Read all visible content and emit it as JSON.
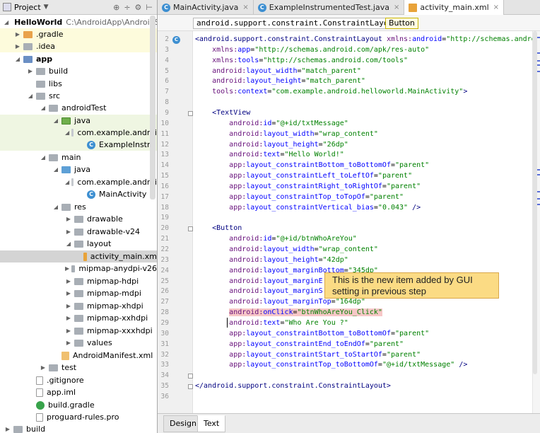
{
  "project_panel": {
    "title": "Project",
    "tree": [
      {
        "label": "HelloWorld",
        "path": "C:\\AndroidApp\\AndroidSt",
        "icon": "module-icon",
        "expanded": true,
        "bold": true
      },
      {
        "label": ".gradle",
        "icon": "folder-icon",
        "expanded": false
      },
      {
        "label": ".idea",
        "icon": "folder-icon",
        "expanded": false
      },
      {
        "label": "app",
        "icon": "module-icon",
        "expanded": true,
        "bold": true
      },
      {
        "label": "build",
        "icon": "folder-icon",
        "expanded": false
      },
      {
        "label": "libs",
        "icon": "folder-icon"
      },
      {
        "label": "src",
        "icon": "folder-icon",
        "expanded": true
      },
      {
        "label": "androidTest",
        "icon": "folder-icon",
        "expanded": true
      },
      {
        "label": "java",
        "icon": "test-source-folder-icon",
        "expanded": true
      },
      {
        "label": "com.example.androi",
        "icon": "package-icon",
        "expanded": true
      },
      {
        "label": "ExampleInstru",
        "icon": "class-icon"
      },
      {
        "label": "main",
        "icon": "folder-icon",
        "expanded": true
      },
      {
        "label": "java",
        "icon": "source-folder-icon",
        "expanded": true
      },
      {
        "label": "com.example.androi",
        "icon": "package-icon",
        "expanded": true
      },
      {
        "label": "MainActivity",
        "icon": "class-icon"
      },
      {
        "label": "res",
        "icon": "resource-folder-icon",
        "expanded": true
      },
      {
        "label": "drawable",
        "icon": "folder-icon",
        "expanded": false
      },
      {
        "label": "drawable-v24",
        "icon": "folder-icon",
        "expanded": false
      },
      {
        "label": "layout",
        "icon": "folder-icon",
        "expanded": true
      },
      {
        "label": "activity_main.xm",
        "icon": "xml-file-icon"
      },
      {
        "label": "mipmap-anydpi-v26",
        "icon": "folder-icon",
        "expanded": false
      },
      {
        "label": "mipmap-hdpi",
        "icon": "folder-icon",
        "expanded": false
      },
      {
        "label": "mipmap-mdpi",
        "icon": "folder-icon",
        "expanded": false
      },
      {
        "label": "mipmap-xhdpi",
        "icon": "folder-icon",
        "expanded": false
      },
      {
        "label": "mipmap-xxhdpi",
        "icon": "folder-icon",
        "expanded": false
      },
      {
        "label": "mipmap-xxxhdpi",
        "icon": "folder-icon",
        "expanded": false
      },
      {
        "label": "values",
        "icon": "folder-icon",
        "expanded": false
      },
      {
        "label": "AndroidManifest.xml",
        "icon": "manifest-file-icon"
      },
      {
        "label": "test",
        "icon": "folder-icon",
        "expanded": false
      },
      {
        "label": ".gitignore",
        "icon": "file-icon"
      },
      {
        "label": "app.iml",
        "icon": "iml-file-icon"
      },
      {
        "label": "build.gradle",
        "icon": "gradle-icon"
      },
      {
        "label": "proguard-rules.pro",
        "icon": "file-icon"
      },
      {
        "label": "build",
        "icon": "folder-icon",
        "expanded": false
      }
    ]
  },
  "tabs": [
    {
      "label": "MainActivity.java",
      "icon": "class-icon"
    },
    {
      "label": "ExampleInstrumentedTest.java",
      "icon": "class-icon"
    },
    {
      "label": "activity_main.xml",
      "icon": "xml-file-icon",
      "active": true
    }
  ],
  "breadcrumb": [
    "android.support.constraint.ConstraintLayout",
    "Button"
  ],
  "editor": {
    "lines": [
      {
        "n": "2"
      },
      {
        "n": "3"
      },
      {
        "n": "4"
      },
      {
        "n": "5"
      },
      {
        "n": "6"
      },
      {
        "n": "7"
      },
      {
        "n": "8"
      },
      {
        "n": "9"
      },
      {
        "n": "10"
      },
      {
        "n": "11"
      },
      {
        "n": "12"
      },
      {
        "n": "13"
      },
      {
        "n": "14"
      },
      {
        "n": "15"
      },
      {
        "n": "16"
      },
      {
        "n": "17"
      },
      {
        "n": "18"
      },
      {
        "n": "19"
      },
      {
        "n": "20"
      },
      {
        "n": "21"
      },
      {
        "n": "22"
      },
      {
        "n": "23"
      },
      {
        "n": "24"
      },
      {
        "n": "25"
      },
      {
        "n": "26"
      },
      {
        "n": "27"
      },
      {
        "n": "28"
      },
      {
        "n": "29"
      },
      {
        "n": "30"
      },
      {
        "n": "31"
      },
      {
        "n": "32"
      },
      {
        "n": "33"
      },
      {
        "n": "34"
      },
      {
        "n": "35"
      },
      {
        "n": "36"
      }
    ],
    "code": [
      [
        [
          "tag",
          "<android.support.constraint.ConstraintLayout "
        ],
        [
          "ns",
          "xmlns:"
        ],
        [
          "attr",
          "android"
        ],
        [
          "bo",
          "="
        ],
        [
          "val",
          "\"http://schemas.android."
        ]
      ],
      [
        [
          "bo",
          "    "
        ],
        [
          "ns",
          "xmlns:"
        ],
        [
          "attr",
          "app"
        ],
        [
          "bo",
          "="
        ],
        [
          "val",
          "\"http://schemas.android.com/apk/res-auto\""
        ]
      ],
      [
        [
          "bo",
          "    "
        ],
        [
          "ns",
          "xmlns:"
        ],
        [
          "attr",
          "tools"
        ],
        [
          "bo",
          "="
        ],
        [
          "val",
          "\"http://schemas.android.com/tools\""
        ]
      ],
      [
        [
          "bo",
          "    "
        ],
        [
          "ns",
          "android:"
        ],
        [
          "attr",
          "layout_width"
        ],
        [
          "bo",
          "="
        ],
        [
          "val",
          "\"match_parent\""
        ]
      ],
      [
        [
          "bo",
          "    "
        ],
        [
          "ns",
          "android:"
        ],
        [
          "attr",
          "layout_height"
        ],
        [
          "bo",
          "="
        ],
        [
          "val",
          "\"match_parent\""
        ]
      ],
      [
        [
          "bo",
          "    "
        ],
        [
          "ns",
          "tools:"
        ],
        [
          "attr",
          "context"
        ],
        [
          "bo",
          "="
        ],
        [
          "val",
          "\"com.example.android.helloworld.MainActivity\""
        ],
        [
          "tag",
          ">"
        ]
      ],
      [],
      [
        [
          "bo",
          "    "
        ],
        [
          "tag",
          "<TextView"
        ]
      ],
      [
        [
          "bo",
          "        "
        ],
        [
          "ns",
          "android:"
        ],
        [
          "attr",
          "id"
        ],
        [
          "bo",
          "="
        ],
        [
          "val",
          "\"@+id/txtMessage\""
        ]
      ],
      [
        [
          "bo",
          "        "
        ],
        [
          "ns",
          "android:"
        ],
        [
          "attr",
          "layout_width"
        ],
        [
          "bo",
          "="
        ],
        [
          "val",
          "\"wrap_content\""
        ]
      ],
      [
        [
          "bo",
          "        "
        ],
        [
          "ns",
          "android:"
        ],
        [
          "attr",
          "layout_height"
        ],
        [
          "bo",
          "="
        ],
        [
          "val",
          "\"26dp\""
        ]
      ],
      [
        [
          "bo",
          "        "
        ],
        [
          "ns",
          "android:"
        ],
        [
          "attr",
          "text"
        ],
        [
          "bo",
          "="
        ],
        [
          "val",
          "\"Hello World!\""
        ]
      ],
      [
        [
          "bo",
          "        "
        ],
        [
          "ns",
          "app:"
        ],
        [
          "attr",
          "layout_constraintBottom_toBottomOf"
        ],
        [
          "bo",
          "="
        ],
        [
          "val",
          "\"parent\""
        ]
      ],
      [
        [
          "bo",
          "        "
        ],
        [
          "ns",
          "app:"
        ],
        [
          "attr",
          "layout_constraintLeft_toLeftOf"
        ],
        [
          "bo",
          "="
        ],
        [
          "val",
          "\"parent\""
        ]
      ],
      [
        [
          "bo",
          "        "
        ],
        [
          "ns",
          "app:"
        ],
        [
          "attr",
          "layout_constraintRight_toRightOf"
        ],
        [
          "bo",
          "="
        ],
        [
          "val",
          "\"parent\""
        ]
      ],
      [
        [
          "bo",
          "        "
        ],
        [
          "ns",
          "app:"
        ],
        [
          "attr",
          "layout_constraintTop_toTopOf"
        ],
        [
          "bo",
          "="
        ],
        [
          "val",
          "\"parent\""
        ]
      ],
      [
        [
          "bo",
          "        "
        ],
        [
          "ns",
          "app:"
        ],
        [
          "attr",
          "layout_constraintVertical_bias"
        ],
        [
          "bo",
          "="
        ],
        [
          "val",
          "\"0.043\""
        ],
        [
          "tag",
          " />"
        ]
      ],
      [],
      [
        [
          "bo",
          "    "
        ],
        [
          "tag",
          "<Button"
        ]
      ],
      [
        [
          "bo",
          "        "
        ],
        [
          "ns",
          "android:"
        ],
        [
          "attr",
          "id"
        ],
        [
          "bo",
          "="
        ],
        [
          "val",
          "\"@+id/btnWhoAreYou\""
        ]
      ],
      [
        [
          "bo",
          "        "
        ],
        [
          "ns",
          "android:"
        ],
        [
          "attr",
          "layout_width"
        ],
        [
          "bo",
          "="
        ],
        [
          "val",
          "\"wrap_content\""
        ]
      ],
      [
        [
          "bo",
          "        "
        ],
        [
          "ns",
          "android:"
        ],
        [
          "attr",
          "layout_height"
        ],
        [
          "bo",
          "="
        ],
        [
          "val",
          "\"42dp\""
        ]
      ],
      [
        [
          "bo",
          "        "
        ],
        [
          "ns",
          "android:"
        ],
        [
          "attr",
          "layout_marginBottom"
        ],
        [
          "bo",
          "="
        ],
        [
          "val",
          "\"345dp\""
        ]
      ],
      [
        [
          "bo",
          "        "
        ],
        [
          "ns",
          "android:"
        ],
        [
          "attr",
          "layout_marginE"
        ]
      ],
      [
        [
          "bo",
          "        "
        ],
        [
          "ns",
          "android:"
        ],
        [
          "attr",
          "layout_marginS"
        ]
      ],
      [
        [
          "bo",
          "        "
        ],
        [
          "ns",
          "android:"
        ],
        [
          "attr",
          "layout_marginTop"
        ],
        [
          "bo",
          "="
        ],
        [
          "val",
          "\"164dp\""
        ]
      ],
      [
        [
          "bo",
          "        "
        ],
        [
          "ns",
          "android:"
        ],
        [
          "attr",
          "onClick"
        ],
        [
          "bo",
          "="
        ],
        [
          "val",
          "\"btnWhoAreYou_Click\""
        ]
      ],
      [
        [
          "bo",
          "        "
        ],
        [
          "ns",
          "android:"
        ],
        [
          "attr",
          "text"
        ],
        [
          "bo",
          "="
        ],
        [
          "val",
          "\"Who Are You ?\""
        ]
      ],
      [
        [
          "bo",
          "        "
        ],
        [
          "ns",
          "app:"
        ],
        [
          "attr",
          "layout_constraintBottom_toBottomOf"
        ],
        [
          "bo",
          "="
        ],
        [
          "val",
          "\"parent\""
        ]
      ],
      [
        [
          "bo",
          "        "
        ],
        [
          "ns",
          "app:"
        ],
        [
          "attr",
          "layout_constraintEnd_toEndOf"
        ],
        [
          "bo",
          "="
        ],
        [
          "val",
          "\"parent\""
        ]
      ],
      [
        [
          "bo",
          "        "
        ],
        [
          "ns",
          "app:"
        ],
        [
          "attr",
          "layout_constraintStart_toStartOf"
        ],
        [
          "bo",
          "="
        ],
        [
          "val",
          "\"parent\""
        ]
      ],
      [
        [
          "bo",
          "        "
        ],
        [
          "ns",
          "app:"
        ],
        [
          "attr",
          "layout_constraintTop_toBottomOf"
        ],
        [
          "bo",
          "="
        ],
        [
          "val",
          "\"@+id/txtMessage\""
        ],
        [
          "tag",
          " />"
        ]
      ],
      [],
      [
        [
          "tag",
          "</android.support.constraint.ConstraintLayout>"
        ]
      ],
      []
    ]
  },
  "callout": {
    "text": "This is the new item added by GUI setting in previous step"
  },
  "bottom_tabs": {
    "design": "Design",
    "text": "Text"
  }
}
